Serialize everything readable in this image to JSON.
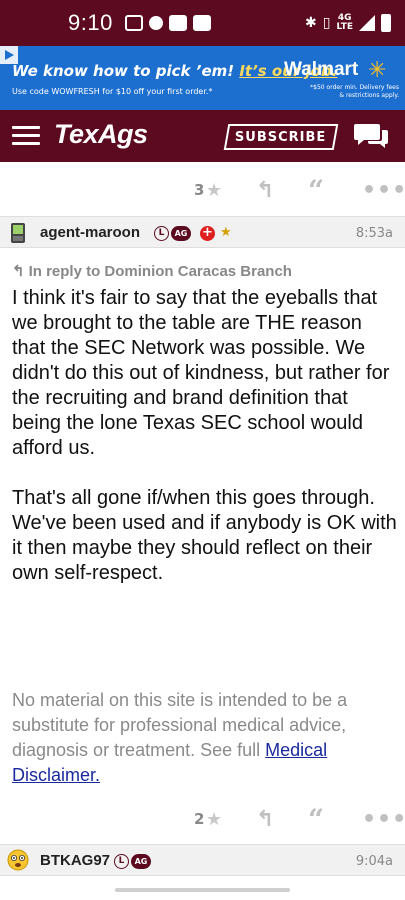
{
  "status_bar": {
    "time": "9:10",
    "network": "4G\nLTE"
  },
  "ad": {
    "headline_part1": "We know how to pick ’em! ",
    "headline_part2": "It’s our job.",
    "subtext": "Use code WOWFRESH for $10 off your first order.*",
    "brand": "Walmart",
    "fine_print": "*$50 order min. Delivery fees & restrictions apply."
  },
  "nav": {
    "logo": "TexAgs",
    "subscribe_label": "SUBSCRIBE"
  },
  "prev_post": {
    "rating_count": "3"
  },
  "post": {
    "username": "agent-maroon",
    "badge_l": "L",
    "badge_ag": "AG",
    "time": "8:53a",
    "reply_to": "In reply to Dominion Caracas Branch",
    "paragraph1": "I think it's fair to say that the eyeballs that we brought to the table are THE reason that the SEC Network was possible. We didn't do this out of kindness, but rather for the recruiting and brand definition that being the lone Texas SEC school would afford us.",
    "paragraph2": "That's all gone if/when this goes through. We've been used and if anybody is OK with it then maybe they should reflect on their own self-respect.",
    "disclaimer_text": "No material on this site is intended to be a substitute for professional medical advice, diagnosis or treatment. See full ",
    "disclaimer_link": "Medical Disclaimer.",
    "rating_count": "2"
  },
  "next_post": {
    "username": "BTKAG97",
    "badge_l": "L",
    "badge_ag": "AG",
    "time": "9:04a"
  },
  "icons": {
    "star": "★",
    "reply": "↰",
    "quote": "“",
    "more": "•••"
  },
  "colors": {
    "maroon": "#5b0a1f",
    "ad_blue": "#1d6fcf",
    "link_blue": "#1a2a9e"
  }
}
